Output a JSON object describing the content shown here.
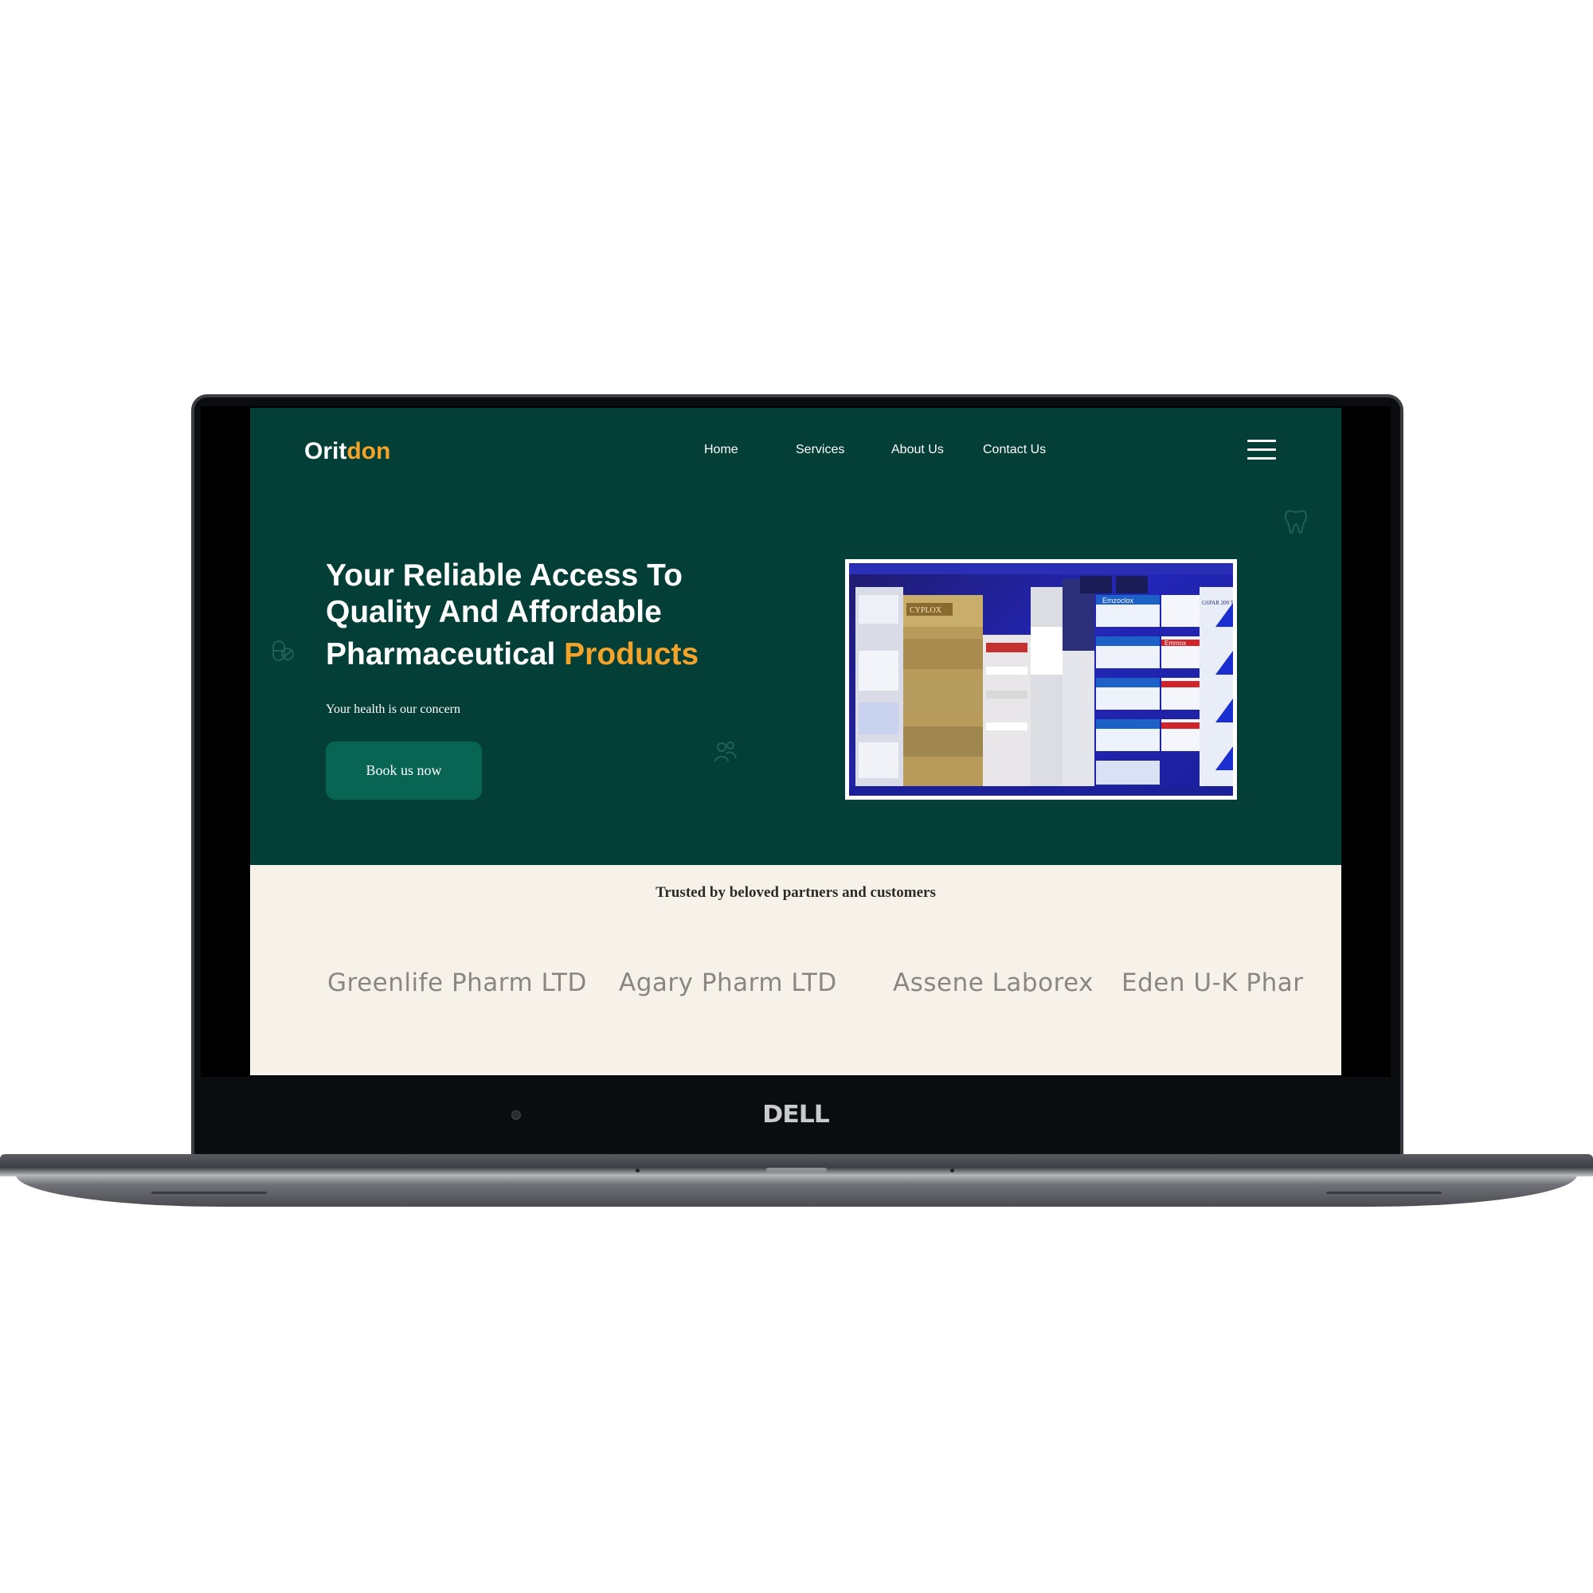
{
  "device": {
    "brand": "DELL"
  },
  "site": {
    "logo_main": "Orit",
    "logo_accent": "don",
    "nav": [
      "Home",
      "Services",
      "About Us",
      "Contact Us"
    ],
    "hero": {
      "title_line1": "Your Reliable Access To",
      "title_line2": "Quality And Affordable",
      "title_line3": "Pharmaceutical",
      "title_accent": "Products",
      "tagline": "Your health is our concern",
      "cta": "Book us now"
    },
    "partners": {
      "heading": "Trusted by beloved partners and customers",
      "names": [
        "Greenlife Pharm LTD",
        "Agary Pharm LTD",
        "Assene Laborex",
        "Eden U-K Phar"
      ]
    }
  },
  "photo_labels": [
    "CYPLOX",
    "Emzoclox",
    "Emmox",
    "GSPAR 200 TABLETS"
  ],
  "icons": [
    "menu-icon",
    "tooth-icon",
    "pill-icon",
    "people-icon"
  ],
  "colors": {
    "hero_bg": "#033e37",
    "accent": "#f4a32a",
    "button": "#086554",
    "partners_bg": "#f6f1e9"
  }
}
